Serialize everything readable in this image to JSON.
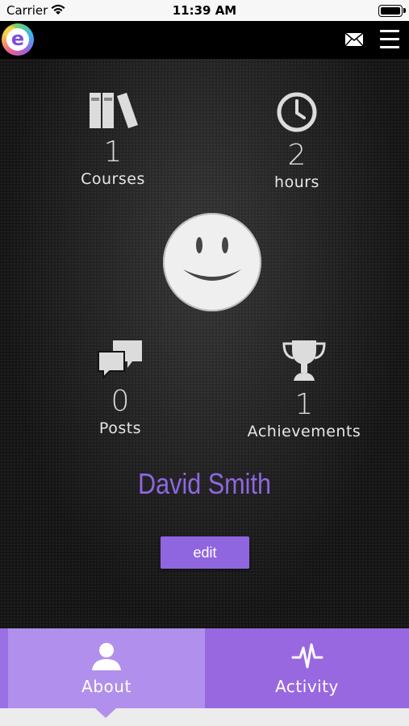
{
  "status_bar": {
    "carrier": "Carrier",
    "time": "11:39 AM"
  },
  "header": {
    "logo_letter": "e",
    "mail_icon": "mail-icon",
    "menu_icon": "hamburger-menu-icon"
  },
  "profile": {
    "stats": {
      "courses": {
        "count": "1",
        "label": "Courses",
        "icon": "books-icon"
      },
      "hours": {
        "count": "2",
        "label": "hours",
        "icon": "clock-icon"
      },
      "posts": {
        "count": "0",
        "label": "Posts",
        "icon": "chat-bubbles-icon"
      },
      "achievements": {
        "count": "1",
        "label": "Achievements",
        "icon": "trophy-icon"
      }
    },
    "avatar_icon": "smiley-avatar-icon",
    "name": "David Smith",
    "edit_label": "edit"
  },
  "tabs": [
    {
      "label": "About",
      "icon": "user-icon",
      "active": true
    },
    {
      "label": "Activity",
      "icon": "pulse-icon",
      "active": false
    }
  ],
  "colors": {
    "accent": "#9066e0",
    "tab_active": "#b090ec",
    "tab_inactive": "#9868e0",
    "name_text": "#8e67e0",
    "background": "#141414"
  }
}
